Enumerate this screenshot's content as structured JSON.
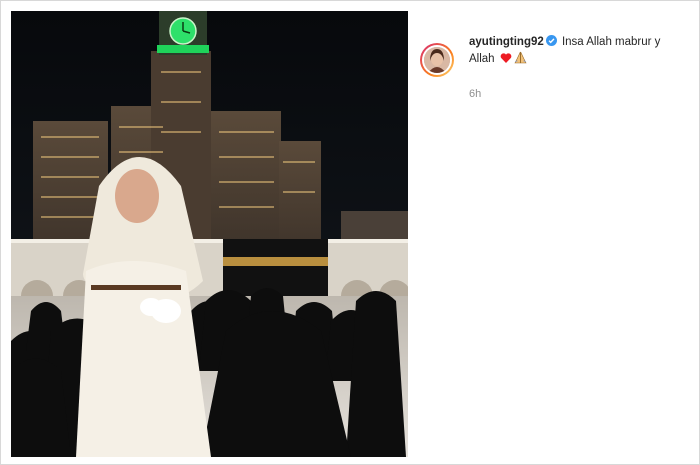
{
  "post": {
    "username": "ayutingting92",
    "caption_text": "Insa Allah mabrur y Allah",
    "timestamp": "6h",
    "colors": {
      "verified": "#3897f0",
      "heart": "#ed1c24",
      "text": "#262626",
      "muted": "#8e8e8e"
    },
    "icons": [
      "verified-badge-icon",
      "red-heart-icon",
      "praying-hands-icon"
    ]
  }
}
